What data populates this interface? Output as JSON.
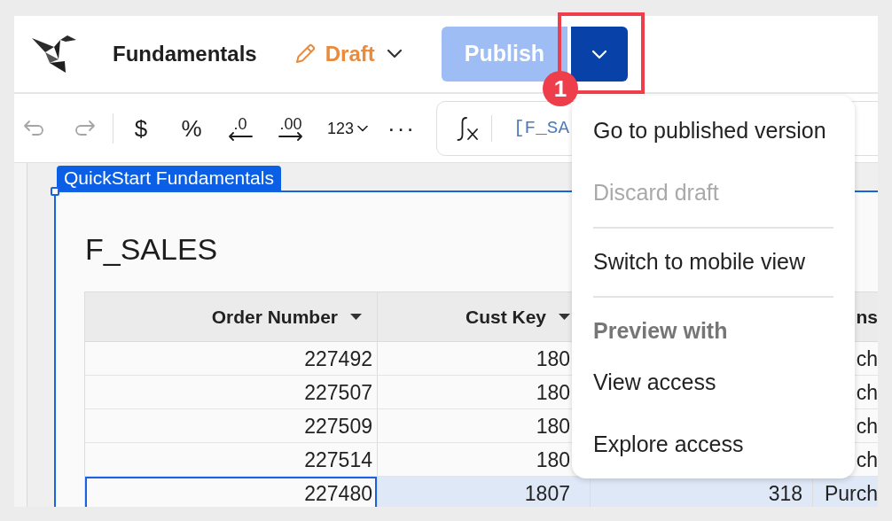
{
  "topbar": {
    "title": "Fundamentals",
    "draft": {
      "label": "Draft"
    },
    "publish": {
      "label": "Publish",
      "disabled": true
    },
    "menu_button": {
      "open": true
    }
  },
  "toolbar": {
    "items": [
      {
        "kind": "undo",
        "disabled": true
      },
      {
        "kind": "redo",
        "disabled": true
      },
      {
        "kind": "separator"
      },
      {
        "kind": "currency",
        "label": "$"
      },
      {
        "kind": "percent",
        "label": "%"
      },
      {
        "kind": "decrease-decimals",
        "label": ".0"
      },
      {
        "kind": "increase-decimals",
        "label": ".00"
      },
      {
        "kind": "number-format",
        "label": "123"
      },
      {
        "kind": "more",
        "label": "···"
      }
    ]
  },
  "formula_bar": {
    "value": "[F_SA"
  },
  "element": {
    "name_tab": "QuickStart Fundamentals",
    "selected": true,
    "title": "F_SALES",
    "table": {
      "columns": [
        {
          "label": "Order Number",
          "menu": true
        },
        {
          "label": "Cust Key",
          "menu": true
        },
        null,
        {
          "label": "ns",
          "menu": false
        }
      ],
      "rows": [
        {
          "cells": [
            "227492",
            "180",
            null,
            "ch"
          ],
          "selected": false
        },
        {
          "cells": [
            "227507",
            "180",
            null,
            "ch"
          ],
          "selected": false
        },
        {
          "cells": [
            "227509",
            "180",
            null,
            "ch"
          ],
          "selected": false
        },
        {
          "cells": [
            "227514",
            "180",
            null,
            "ch"
          ],
          "selected": false
        },
        {
          "cells": [
            "227480",
            "1807",
            "318",
            "Purch"
          ],
          "selected": true
        }
      ]
    }
  },
  "publish_menu": {
    "items": [
      {
        "kind": "item",
        "label": "Go to published version",
        "disabled": false
      },
      {
        "kind": "item",
        "label": "Discard draft",
        "disabled": true
      },
      {
        "kind": "divider"
      },
      {
        "kind": "item",
        "label": "Switch to mobile view",
        "disabled": false
      },
      {
        "kind": "divider"
      },
      {
        "kind": "header",
        "label": "Preview with"
      },
      {
        "kind": "item",
        "label": "View access",
        "disabled": false
      },
      {
        "kind": "item",
        "label": "Explore access",
        "disabled": false
      }
    ]
  },
  "annotation": {
    "badge": "1"
  }
}
